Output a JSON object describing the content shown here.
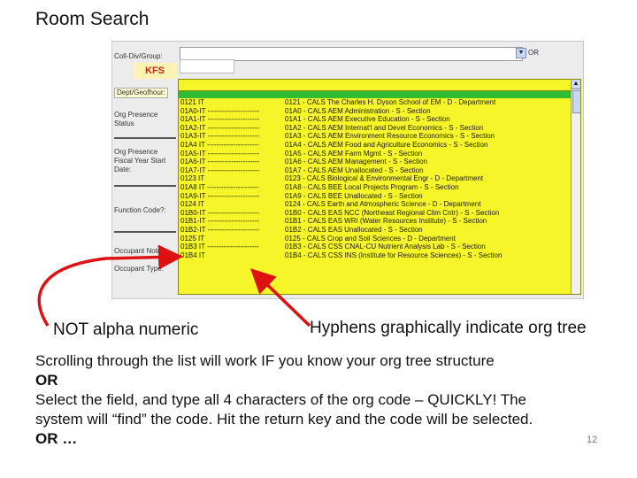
{
  "slide": {
    "title": "Room Search",
    "page_number": "12"
  },
  "screenshot": {
    "labels": {
      "coll_div": "Coll-Div/Group:",
      "kfs": "KFS",
      "dept": "Dept/Geofhour:",
      "org_presence": "Org Presence Status",
      "org_presence_date": "Org Presence Fiscal Year Start Date:",
      "function_code": "Function Code?:",
      "occupant_notes": "Occupant Notes:",
      "occupant_type": "Occupant Type:",
      "or": "OR"
    },
    "dropdown_rows": [
      {
        "code": "0121 IT",
        "desc": "0121 - CALS The Charles H. Dyson School of EM - D - Department"
      },
      {
        "code": "01A0-IT ----------------------",
        "desc": "01A0 - CALS AEM Administration - S - Section"
      },
      {
        "code": "01A1-IT ----------------------",
        "desc": "01A1 - CALS AEM Executive Education - S - Section"
      },
      {
        "code": "01A2-IT ----------------------",
        "desc": "01A2 - CALS AEM Internat'l and Devel Economics - S - Section"
      },
      {
        "code": "01A3-IT ----------------------",
        "desc": "01A3 - CALS AEM Environment Resource Economics - S - Section"
      },
      {
        "code": "01A4 IT ----------------------",
        "desc": "01A4 - CALS AEM Food and Agriculture Economics - S - Section"
      },
      {
        "code": "01A5-IT ----------------------",
        "desc": "01A5 - CALS AEM Farm Mgmt - S - Section"
      },
      {
        "code": "01A6-IT ----------------------",
        "desc": "01A6 - CALS AEM Management - S - Section"
      },
      {
        "code": "01A7-IT ----------------------",
        "desc": "01A7 - CALS AEM Unallocated - S - Section"
      },
      {
        "code": "0123 IT",
        "desc": "0123 - CALS Biological & Environmental Engr - D - Department"
      },
      {
        "code": "01A8 IT ----------------------",
        "desc": "01A8 - CALS BEE Local Projects Program - S - Section"
      },
      {
        "code": "01A9-IT ----------------------",
        "desc": "01A9 - CALS BEE Unallocated - S - Section"
      },
      {
        "code": "0124 IT",
        "desc": "0124 - CALS Earth and Atmospheric Science - D - Department"
      },
      {
        "code": "01B0-IT ----------------------",
        "desc": "01B0 - CALS EAS NCC (Northeast Regional Clim Cntr) - S - Section"
      },
      {
        "code": "01B1-IT ----------------------",
        "desc": "01B1 - CALS EAS WRI (Water Resources Institute) - S - Section"
      },
      {
        "code": "01B2-IT ----------------------",
        "desc": "01B2 - CALS EAS Unallocated - S - Section"
      },
      {
        "code": "0125 IT",
        "desc": "0125 - CALS Crop and Soil Sciences - D - Department"
      },
      {
        "code": "01B3 IT ----------------------",
        "desc": "01B3 - CALS CSS CNAL-CU Nutrient Analysis Lab - S - Section"
      },
      {
        "code": "01B4 IT",
        "desc": "01B4 - CALS CSS INS (Institute for Resource Sciences) - S - Section"
      }
    ]
  },
  "callouts": {
    "left": "NOT alpha numeric",
    "right": "Hyphens graphically indicate org tree"
  },
  "body_lines": {
    "l1": "Scrolling through the list will work IF you know your org tree structure",
    "l2": "OR",
    "l3": "Select the field, and type all 4 characters of the org code – QUICKLY!  The",
    "l4": "system will “find” the code.  Hit the return key and the code will be selected.",
    "l5": "OR  …"
  },
  "colors": {
    "dropdown_bg": "#f5f52a",
    "arrow": "#dd1111",
    "kfs_text": "#d12020"
  }
}
